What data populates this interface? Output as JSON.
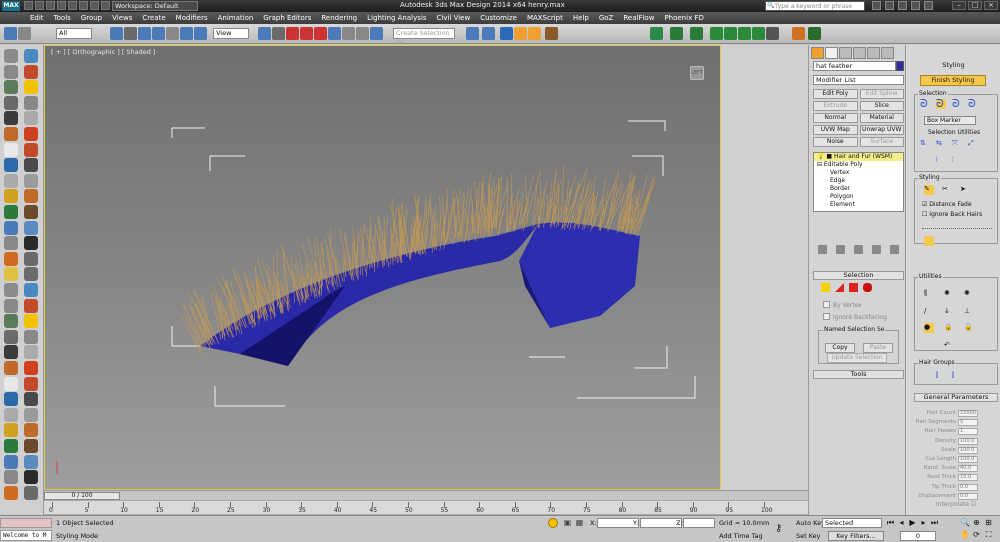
{
  "titlebar": {
    "workspace": "Workspace: Default",
    "window_title": "Autodesk 3ds Max Design 2014 x64     henry.max",
    "search_placeholder": "Type a keyword or phrase"
  },
  "menu": [
    "Edit",
    "Tools",
    "Group",
    "Views",
    "Create",
    "Modifiers",
    "Animation",
    "Graph Editors",
    "Rendering",
    "Lighting Analysis",
    "Civil View",
    "Customize",
    "MAXScript",
    "Help",
    "GoZ",
    "RealFlow",
    "Phoenix FD"
  ],
  "toolbar": {
    "selection_filter": "All",
    "ref_coord": "View",
    "named_selection_placeholder": "Create Selection Se"
  },
  "viewport": {
    "label": "[ + ] [ Orthographic ] [ Shaded ]",
    "cube_label": "LEFT"
  },
  "timeline": {
    "slider": "0 / 100",
    "ticks": [
      "0",
      "5",
      "10",
      "15",
      "20",
      "25",
      "30",
      "35",
      "40",
      "45",
      "50",
      "55",
      "60",
      "65",
      "70",
      "75",
      "80",
      "85",
      "90",
      "95",
      "100"
    ]
  },
  "status": {
    "selection_count": "1 Object Selected",
    "prompt": "Styling Mode",
    "listener": "Welcome to M",
    "x_label": "X:",
    "y_label": "Y:",
    "z_label": "Z:",
    "grid": "Grid = 10.0mm",
    "add_time_tag": "Add Time Tag",
    "auto_key": "Auto Key",
    "set_key": "Set Key",
    "selected": "Selected",
    "key_filters": "Key Filters...",
    "frame": "0"
  },
  "command_panel": {
    "object_name": "hat feather",
    "modifier_list": "Modifier List",
    "mod_buttons": [
      {
        "label": "Edit Poly",
        "enabled": true
      },
      {
        "label": "Edit Spline",
        "enabled": false
      },
      {
        "label": "Extrude",
        "enabled": false
      },
      {
        "label": "Slice",
        "enabled": true
      },
      {
        "label": "Normal",
        "enabled": true
      },
      {
        "label": "Material",
        "enabled": true
      },
      {
        "label": "UVW Map",
        "enabled": true
      },
      {
        "label": "Unwrap UVW",
        "enabled": true
      },
      {
        "label": "Noise",
        "enabled": true
      },
      {
        "label": "Surface",
        "enabled": false
      }
    ],
    "stack": [
      "Hair and Fur (WSM)",
      "Editable Poly",
      "Vertex",
      "Edge",
      "Border",
      "Polygon",
      "Element"
    ],
    "selection_title": "Selection",
    "by_vertex": "By Vertex",
    "ignore_backfacing": "Ignore Backfacing",
    "named_sel_title": "Named Selection Se",
    "copy": "Copy",
    "paste": "Paste",
    "update_selection": "Update Selection",
    "tools_title": "Tools"
  },
  "styling_panel": {
    "title": "Styling",
    "finish": "Finish Styling",
    "selection": "Selection",
    "box_marker": "Box Marker",
    "selection_utilities": "Selection Utilities",
    "styling": "Styling",
    "distance_fade": "Distance Fade",
    "ignore_back_hairs": "Ignore Back Hairs",
    "utilities": "Utilities",
    "hair_groups": "Hair Groups",
    "general_parameters": "General Parameters",
    "params": [
      {
        "label": "Hair Count",
        "value": "15000"
      },
      {
        "label": "Hair Segments",
        "value": "5"
      },
      {
        "label": "Hair Passes",
        "value": "1"
      },
      {
        "label": "Density",
        "value": "100.0"
      },
      {
        "label": "Scale",
        "value": "100.0"
      },
      {
        "label": "Cut Length",
        "value": "100.0"
      },
      {
        "label": "Rand. Scale",
        "value": "40.0"
      },
      {
        "label": "Root Thick",
        "value": "15.0"
      },
      {
        "label": "Tip Thick",
        "value": "0.0"
      },
      {
        "label": "Displacement",
        "value": "0.0"
      }
    ],
    "interpolate": "Interpolate"
  },
  "colors": {
    "accent_yellow": "#f4c84a",
    "mesh_blue": "#2e2ea8",
    "hair": "#c8a050",
    "viewport_border": "#e2c84a"
  }
}
